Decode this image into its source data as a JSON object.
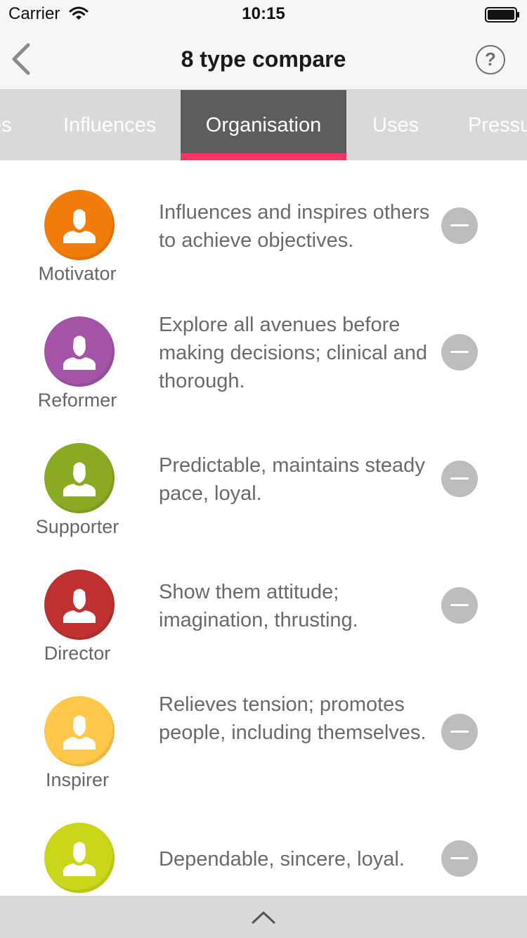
{
  "status_bar": {
    "carrier": "Carrier",
    "time": "10:15"
  },
  "nav": {
    "title": "8 type compare",
    "back_icon": "chevron-left-icon",
    "help_label": "?"
  },
  "tabs": [
    {
      "label": "es",
      "active": false
    },
    {
      "label": "Influences",
      "active": false
    },
    {
      "label": "Organisation",
      "active": true
    },
    {
      "label": "Uses",
      "active": false
    },
    {
      "label": "Pressu",
      "active": false
    }
  ],
  "types": [
    {
      "name": "Motivator",
      "color": "#f07d0a",
      "description": "Influences and inspires others to achieve objectives."
    },
    {
      "name": "Reformer",
      "color": "#a354a6",
      "description": "Explore all avenues before making decisions; clinical and thorough."
    },
    {
      "name": "Supporter",
      "color": "#8aaa24",
      "description": "Predictable, maintains steady pace, loyal."
    },
    {
      "name": "Director",
      "color": "#bf3131",
      "description": "Show them attitude; imagination, thrusting."
    },
    {
      "name": "Inspirer",
      "color": "#ffc84a",
      "description": "Relieves tension; promotes people, including themselves."
    },
    {
      "name": "",
      "color": "#c9d61a",
      "description": "Dependable, sincere, loyal."
    }
  ],
  "colors": {
    "accent": "#ff3366",
    "tab_active_bg": "#5d5d5d",
    "tab_strip_bg": "#d9d9d9",
    "remove_button": "#bdbdbd"
  },
  "icons": {
    "avatar": "person-icon",
    "remove": "minus-circle-icon",
    "expand": "chevron-up-icon"
  }
}
